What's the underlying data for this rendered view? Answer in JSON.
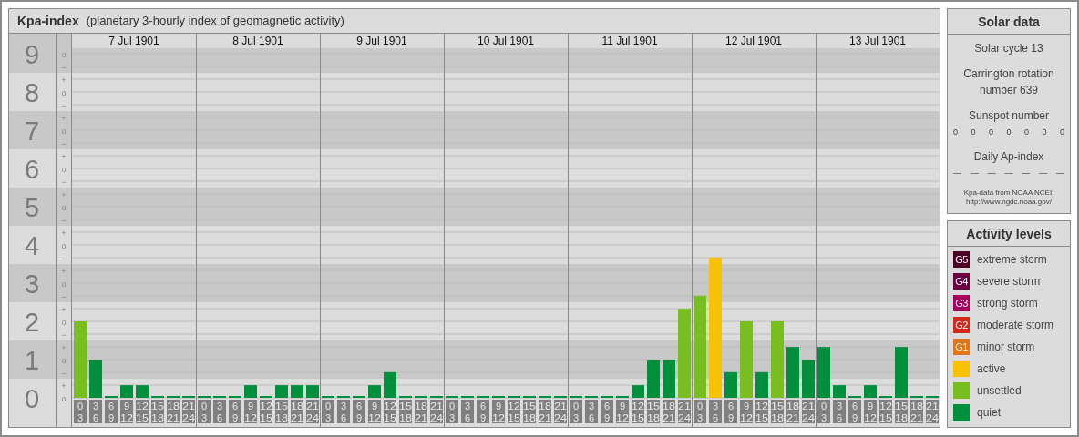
{
  "kpa_panel": {
    "title": "Kpa-index",
    "subtitle": "(planetary 3-hourly index of geomagnetic activity)",
    "days": [
      "7 Jul 1901",
      "8 Jul 1901",
      "9 Jul 1901",
      "10 Jul 1901",
      "11 Jul 1901",
      "12 Jul 1901",
      "13 Jul 1901"
    ],
    "sublevel_ticks": [
      "o",
      "−",
      "+",
      "o",
      "−",
      "+",
      "o",
      "−",
      "+",
      "o",
      "−",
      "+",
      "o",
      "−",
      "+",
      "o",
      "−",
      "+",
      "o",
      "−",
      "+",
      "o",
      "−",
      "+",
      "o",
      "−",
      "+",
      "o"
    ],
    "chart_data": {
      "type": "bar",
      "grid": true,
      "ylim": [
        0,
        9
      ],
      "yticks": [
        0,
        1,
        2,
        3,
        4,
        5,
        6,
        7,
        8,
        9
      ],
      "categories": [
        "0 3",
        "3 6",
        "6 9",
        "9 12",
        "12 15",
        "15 18",
        "18 21",
        "21 24",
        "0 3",
        "3 6",
        "6 9",
        "9 12",
        "12 15",
        "15 18",
        "18 21",
        "21 24",
        "0 3",
        "3 6",
        "6 9",
        "9 12",
        "12 15",
        "15 18",
        "18 21",
        "21 24",
        "0 3",
        "3 6",
        "6 9",
        "9 12",
        "12 15",
        "15 18",
        "18 21",
        "21 24",
        "0 3",
        "3 6",
        "6 9",
        "9 12",
        "12 15",
        "15 18",
        "18 21",
        "21 24",
        "0 3",
        "3 6",
        "6 9",
        "9 12",
        "12 15",
        "15 18",
        "18 21",
        "21 24",
        "0 3",
        "3 6",
        "6 9",
        "9 12",
        "12 15",
        "15 18",
        "18 21",
        "21 24"
      ],
      "values": [
        2,
        1,
        0,
        0.33,
        0.33,
        0,
        0,
        0,
        0,
        0,
        0,
        0.33,
        0,
        0.33,
        0.33,
        0.33,
        0,
        0,
        0,
        0.33,
        0.67,
        0,
        0,
        0,
        0,
        0,
        0,
        0,
        0,
        0,
        0,
        0,
        0,
        0,
        0,
        0,
        0.33,
        1,
        1,
        2.33,
        2.67,
        3.67,
        0.67,
        2,
        0.67,
        2,
        1.33,
        1,
        1.33,
        0.33,
        0,
        0.33,
        0,
        1.33,
        0,
        0
      ]
    }
  },
  "solar_data": {
    "title": "Solar data",
    "solar_cycle": "Solar cycle 13",
    "carrington": "Carrington rotation number 639",
    "sunspot_title": "Sunspot number",
    "sunspots": [
      "0",
      "0",
      "0",
      "0",
      "0",
      "0",
      "0"
    ],
    "ap_title": "Daily Ap-index",
    "ap_values": [
      "—",
      "—",
      "—",
      "—",
      "—",
      "—",
      "—"
    ],
    "source": "Kpa-data from NOAA NCEI: http://www.ngdc.noaa.gov/"
  },
  "activity_levels": {
    "title": "Activity levels",
    "items": [
      {
        "badge": "G5",
        "label": "extreme storm",
        "color": "#4d0026"
      },
      {
        "badge": "G4",
        "label": "severe storm",
        "color": "#6b0042"
      },
      {
        "badge": "G3",
        "label": "strong storm",
        "color": "#a8005e"
      },
      {
        "badge": "G2",
        "label": "moderate storm",
        "color": "#d42a1c"
      },
      {
        "badge": "G1",
        "label": "minor storm",
        "color": "#e0751a"
      },
      {
        "label": "active",
        "color": "#f8c200"
      },
      {
        "label": "unsettled",
        "color": "#78be20"
      },
      {
        "label": "quiet",
        "color": "#008f3c"
      }
    ]
  }
}
